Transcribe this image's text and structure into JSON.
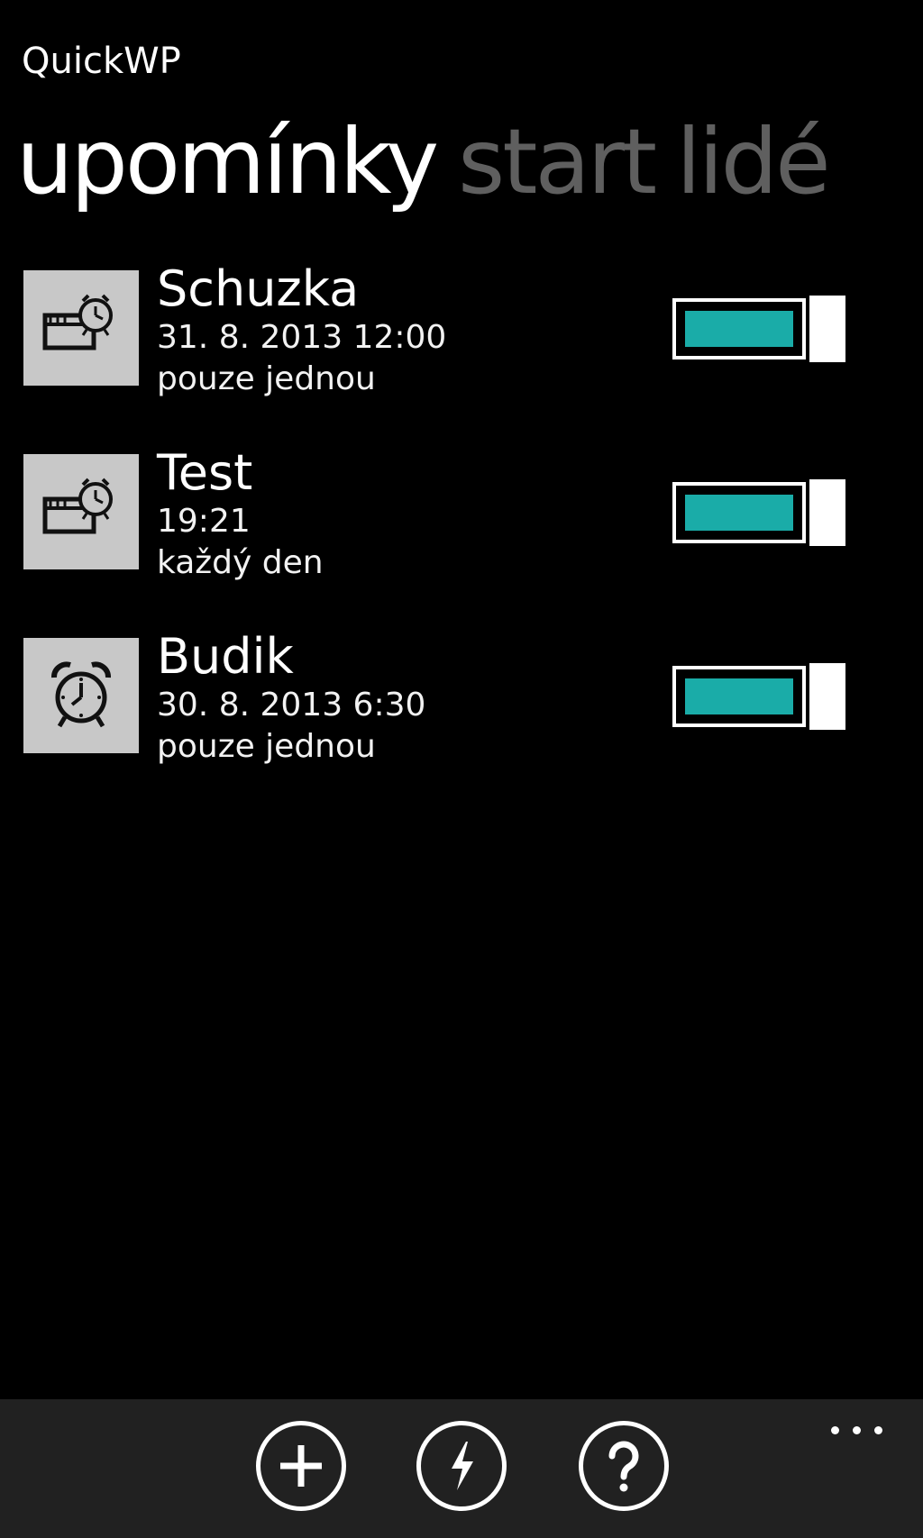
{
  "app": {
    "title": "QuickWP"
  },
  "pivot": {
    "tabs": [
      {
        "label": "upomínky",
        "active": true
      },
      {
        "label": "start",
        "active": false
      },
      {
        "label": "lidé",
        "active": false
      }
    ]
  },
  "reminders": [
    {
      "title": "Schuzka",
      "datetime": "31. 8. 2013 12:00",
      "repeat": "pouze jednou",
      "icon": "reminder-calendar-clock-icon",
      "enabled": true
    },
    {
      "title": "Test",
      "datetime": "19:21",
      "repeat": "každý den",
      "icon": "reminder-calendar-clock-icon",
      "enabled": true
    },
    {
      "title": "Budik",
      "datetime": "30. 8. 2013 6:30",
      "repeat": "pouze jednou",
      "icon": "alarm-clock-icon",
      "enabled": true
    }
  ],
  "appbar": {
    "buttons": [
      {
        "icon": "add-icon"
      },
      {
        "icon": "lightning-icon"
      },
      {
        "icon": "help-icon"
      }
    ],
    "more_icon": "ellipsis-icon"
  },
  "colors": {
    "background": "#000000",
    "accent": "#1aaca8",
    "tile": "#c8c8c8",
    "appbar": "#212121",
    "inactive_tab": "#5f5f5f"
  }
}
